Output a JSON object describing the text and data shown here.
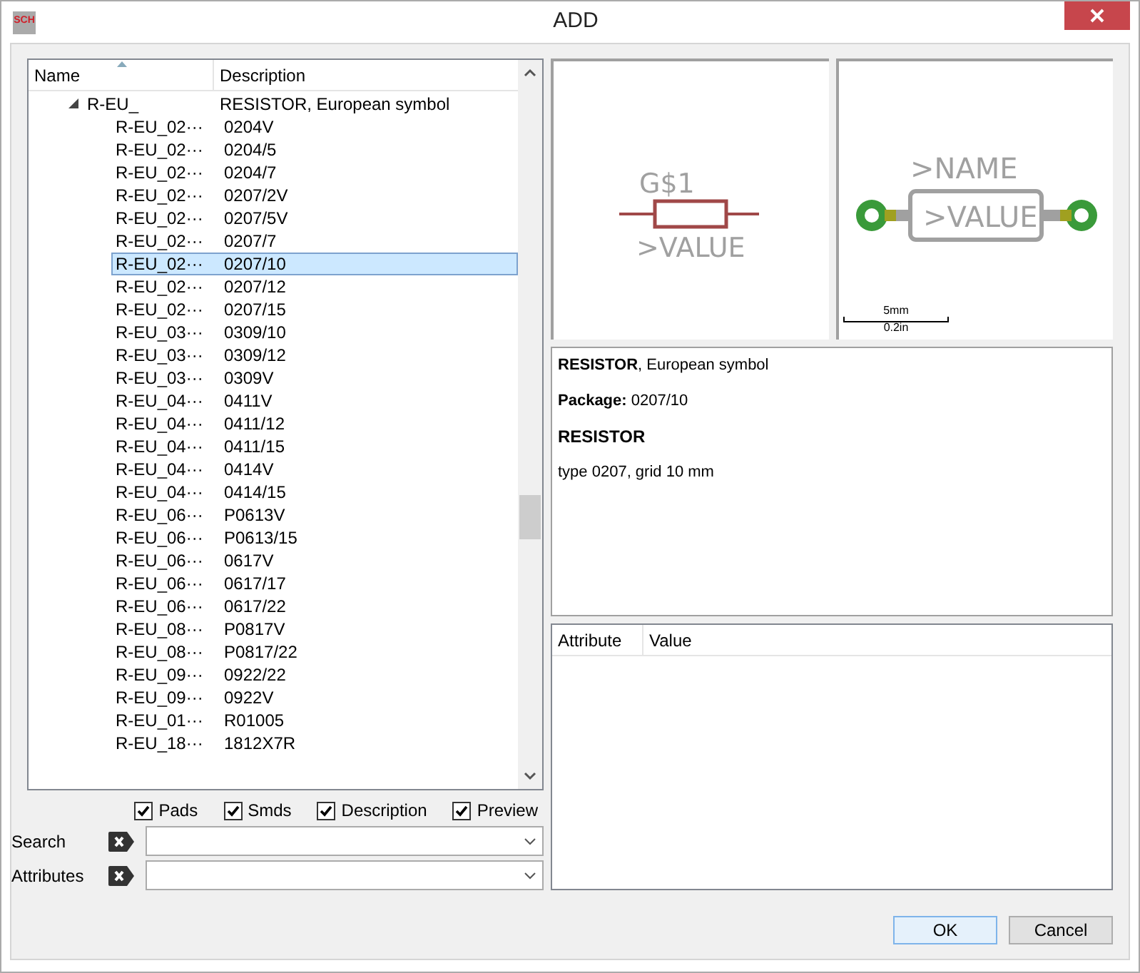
{
  "window": {
    "title": "ADD",
    "app_icon": "SCH"
  },
  "tree": {
    "columns": [
      "Name",
      "Description"
    ],
    "root": {
      "name": "R-EU_",
      "description": "RESISTOR, European symbol",
      "expanded": true,
      "children": [
        {
          "name": "R-EU_02···",
          "description": "0204V",
          "selected": false
        },
        {
          "name": "R-EU_02···",
          "description": "0204/5",
          "selected": false
        },
        {
          "name": "R-EU_02···",
          "description": "0204/7",
          "selected": false
        },
        {
          "name": "R-EU_02···",
          "description": "0207/2V",
          "selected": false
        },
        {
          "name": "R-EU_02···",
          "description": "0207/5V",
          "selected": false
        },
        {
          "name": "R-EU_02···",
          "description": "0207/7",
          "selected": false
        },
        {
          "name": "R-EU_02···",
          "description": "0207/10",
          "selected": true
        },
        {
          "name": "R-EU_02···",
          "description": "0207/12",
          "selected": false
        },
        {
          "name": "R-EU_02···",
          "description": "0207/15",
          "selected": false
        },
        {
          "name": "R-EU_03···",
          "description": "0309/10",
          "selected": false
        },
        {
          "name": "R-EU_03···",
          "description": "0309/12",
          "selected": false
        },
        {
          "name": "R-EU_03···",
          "description": "0309V",
          "selected": false
        },
        {
          "name": "R-EU_04···",
          "description": "0411V",
          "selected": false
        },
        {
          "name": "R-EU_04···",
          "description": "0411/12",
          "selected": false
        },
        {
          "name": "R-EU_04···",
          "description": "0411/15",
          "selected": false
        },
        {
          "name": "R-EU_04···",
          "description": "0414V",
          "selected": false
        },
        {
          "name": "R-EU_04···",
          "description": "0414/15",
          "selected": false
        },
        {
          "name": "R-EU_06···",
          "description": "P0613V",
          "selected": false
        },
        {
          "name": "R-EU_06···",
          "description": "P0613/15",
          "selected": false
        },
        {
          "name": "R-EU_06···",
          "description": "0617V",
          "selected": false
        },
        {
          "name": "R-EU_06···",
          "description": "0617/17",
          "selected": false
        },
        {
          "name": "R-EU_06···",
          "description": "0617/22",
          "selected": false
        },
        {
          "name": "R-EU_08···",
          "description": "P0817V",
          "selected": false
        },
        {
          "name": "R-EU_08···",
          "description": "P0817/22",
          "selected": false
        },
        {
          "name": "R-EU_09···",
          "description": "0922/22",
          "selected": false
        },
        {
          "name": "R-EU_09···",
          "description": "0922V",
          "selected": false
        },
        {
          "name": "R-EU_01···",
          "description": "R01005",
          "selected": false
        },
        {
          "name": "R-EU_18···",
          "description": "1812X7R",
          "selected": false
        }
      ]
    }
  },
  "options": [
    {
      "label": "Pads",
      "checked": true
    },
    {
      "label": "Smds",
      "checked": true
    },
    {
      "label": "Description",
      "checked": true
    },
    {
      "label": "Preview",
      "checked": true
    }
  ],
  "search": {
    "label": "Search"
  },
  "attributes_filter": {
    "label": "Attributes"
  },
  "symbol_preview": {
    "name": "G$1",
    "value": ">VALUE"
  },
  "package_preview": {
    "name": ">NAME",
    "value": ">VALUE",
    "scale_metric": "5mm",
    "scale_imperial": "0.2in"
  },
  "description": [
    {
      "kind": "text",
      "text": "**RESISTOR**, European symbol"
    },
    {
      "kind": "text",
      "text": "**Package:** 0207/10"
    },
    {
      "kind": "heading",
      "text": "RESISTOR"
    },
    {
      "kind": "text",
      "text": "type 0207, grid 10 mm"
    }
  ],
  "attribute_table": {
    "columns": [
      "Attribute",
      "Value"
    ]
  },
  "buttons": [
    "OK",
    "Cancel"
  ]
}
